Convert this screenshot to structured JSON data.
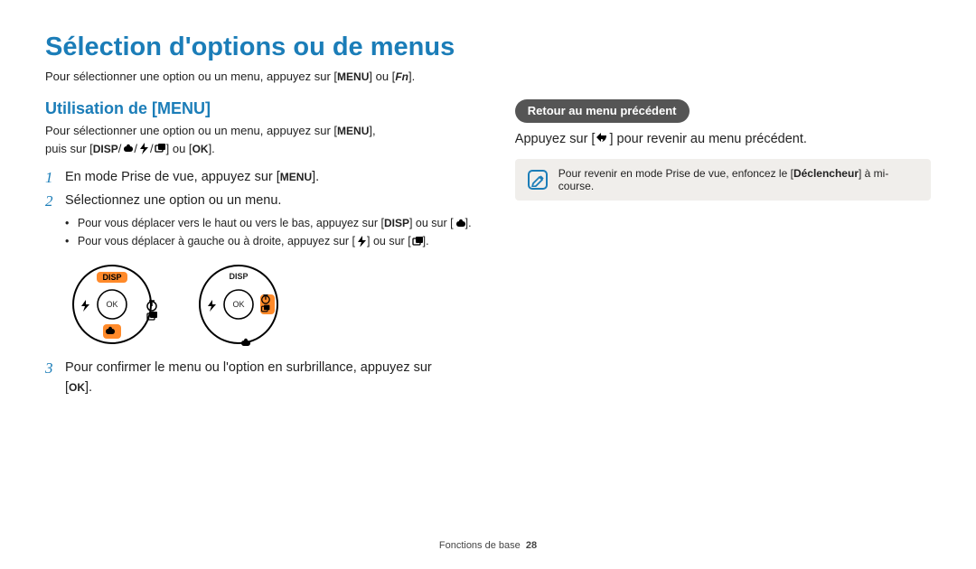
{
  "title": "Sélection d'options ou de menus",
  "intro_prefix": "Pour sélectionner une option ou un menu, appuyez sur [",
  "intro_menu": "MENU",
  "intro_mid": "] ou [",
  "intro_fn": "Fn",
  "intro_suffix": "].",
  "left": {
    "heading": "Utilisation de [MENU]",
    "desc_a": "Pour sélectionner une option ou un menu, appuyez sur [",
    "desc_menu": "MENU",
    "desc_b": "],",
    "desc_c": "puis sur [",
    "desc_disp": "DISP",
    "desc_sep": "/",
    "desc_d": "] ou [",
    "desc_ok": "OK",
    "desc_e": "].",
    "step1_a": "En mode Prise de vue, appuyez sur [",
    "step1_menu": "MENU",
    "step1_b": "].",
    "step2": "Sélectionnez une option ou un menu.",
    "sub1_a": "Pour vous déplacer vers le haut ou vers le bas, appuyez sur [",
    "sub1_disp": "DISP",
    "sub1_b": "] ou sur [",
    "sub1_c": "].",
    "sub2_a": "Pour vous déplacer à gauche ou à droite, appuyez sur [",
    "sub2_b": "] ou sur [",
    "sub2_c": "].",
    "step3_a": "Pour confirmer le menu ou l'option en surbrillance, appuyez sur",
    "step3_b": "[",
    "step3_ok": "OK",
    "step3_c": "].",
    "n1": "1",
    "n2": "2",
    "n3": "3",
    "dial_disp": "DISP",
    "dial_ok": "OK"
  },
  "right": {
    "pill": "Retour au menu précédent",
    "body_a": "Appuyez sur [",
    "body_b": "] pour revenir au menu précédent.",
    "note_a": "Pour revenir en mode Prise de vue, enfoncez le [",
    "note_bold": "Déclencheur",
    "note_b": "] à mi-course."
  },
  "footer": {
    "section": "Fonctions de base",
    "page": "28"
  }
}
